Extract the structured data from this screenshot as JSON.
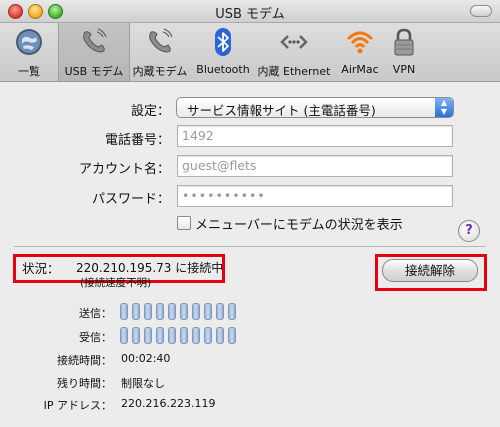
{
  "window": {
    "title": "USB モデム"
  },
  "toolbar": {
    "items": [
      {
        "label": "一覧",
        "icon": "show-all-icon"
      },
      {
        "label": "USB モデム",
        "icon": "usb-modem-phone-icon",
        "selected": true
      },
      {
        "label": "内蔵モデム",
        "icon": "internal-modem-phone-icon"
      },
      {
        "label": "Bluetooth",
        "icon": "bluetooth-icon"
      },
      {
        "label": "内蔵 Ethernet",
        "icon": "ethernet-icon"
      },
      {
        "label": "AirMac",
        "icon": "airmac-wifi-icon"
      },
      {
        "label": "VPN",
        "icon": "vpn-lock-icon"
      }
    ]
  },
  "form": {
    "settings_label": "設定：",
    "settings_value": "サービス情報サイト (主電話番号)",
    "phone_label": "電話番号：",
    "phone_value": "1492",
    "account_label": "アカウント名：",
    "account_value": "guest@flets",
    "password_label": "パスワード：",
    "password_value": "••••••••••",
    "menu_checkbox_label": "メニューバーにモデムの状況を表示",
    "menu_checkbox_checked": false,
    "help_label": "?"
  },
  "status": {
    "label": "状況：",
    "text": "220.210.195.73 に接続中",
    "sub": "(接続速度不明)",
    "disconnect_label": "接続解除",
    "highlight_color": "#e4000f"
  },
  "meters": {
    "send_label": "送信：",
    "receive_label": "受信：",
    "segments": 10,
    "send_level": 0,
    "receive_level": 0
  },
  "info": {
    "time_label": "接続時間：",
    "time_value": "00:02:40",
    "remaining_label": "残り時間：",
    "remaining_value": "制限なし",
    "ip_label": "IP アドレス：",
    "ip_value": "220.216.223.119"
  }
}
